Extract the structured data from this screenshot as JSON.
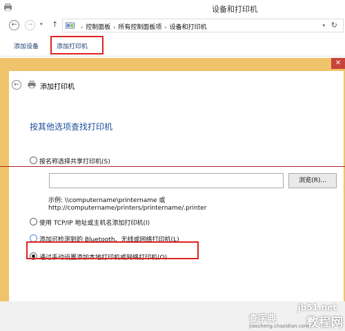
{
  "window": {
    "title": "设备和打印机",
    "icon": "devices-printers-icon"
  },
  "address_bar": {
    "breadcrumbs": [
      "控制面板",
      "所有控制面板项",
      "设备和打印机"
    ],
    "separator": "›",
    "dropdown_glyph": "▾",
    "refresh_glyph": "↻"
  },
  "nav": {
    "back_glyph": "←",
    "forward_glyph": "→",
    "up_glyph": "↑",
    "recent_glyph": "▾"
  },
  "command_bar": {
    "add_device": "添加设备",
    "add_printer": "添加打印机"
  },
  "wizard": {
    "title": "添加打印机",
    "close_glyph": "✕",
    "back_glyph": "←",
    "heading": "按其他选项查找打印机",
    "options": {
      "share_by_name": "按名称选择共享打印机(S)",
      "tcp_ip": "使用 TCP/IP 地址或主机名添加打印机(I)",
      "bluetooth": "添加可检测到的 Bluetooth、无线或网络打印机(L)",
      "manual": "通过手动设置添加本地打印机或网络打印机(O)"
    },
    "selected_option": "manual",
    "name_input_value": "",
    "browse_button": "浏览(R)...",
    "example_line1": "示例: \\\\computername\\printername 或",
    "example_line2": "http://computername/printers/printername/.printer"
  },
  "watermark": {
    "site": "jb51.net",
    "text_right": "教程网",
    "text_left": "查字典",
    "url": "jiaocheng.chazidian.com"
  },
  "colors": {
    "wizard_frame": "#efc36a",
    "highlight_box": "#e02020",
    "heading_blue": "#1b4d9e",
    "close_button": "#c8443a"
  }
}
